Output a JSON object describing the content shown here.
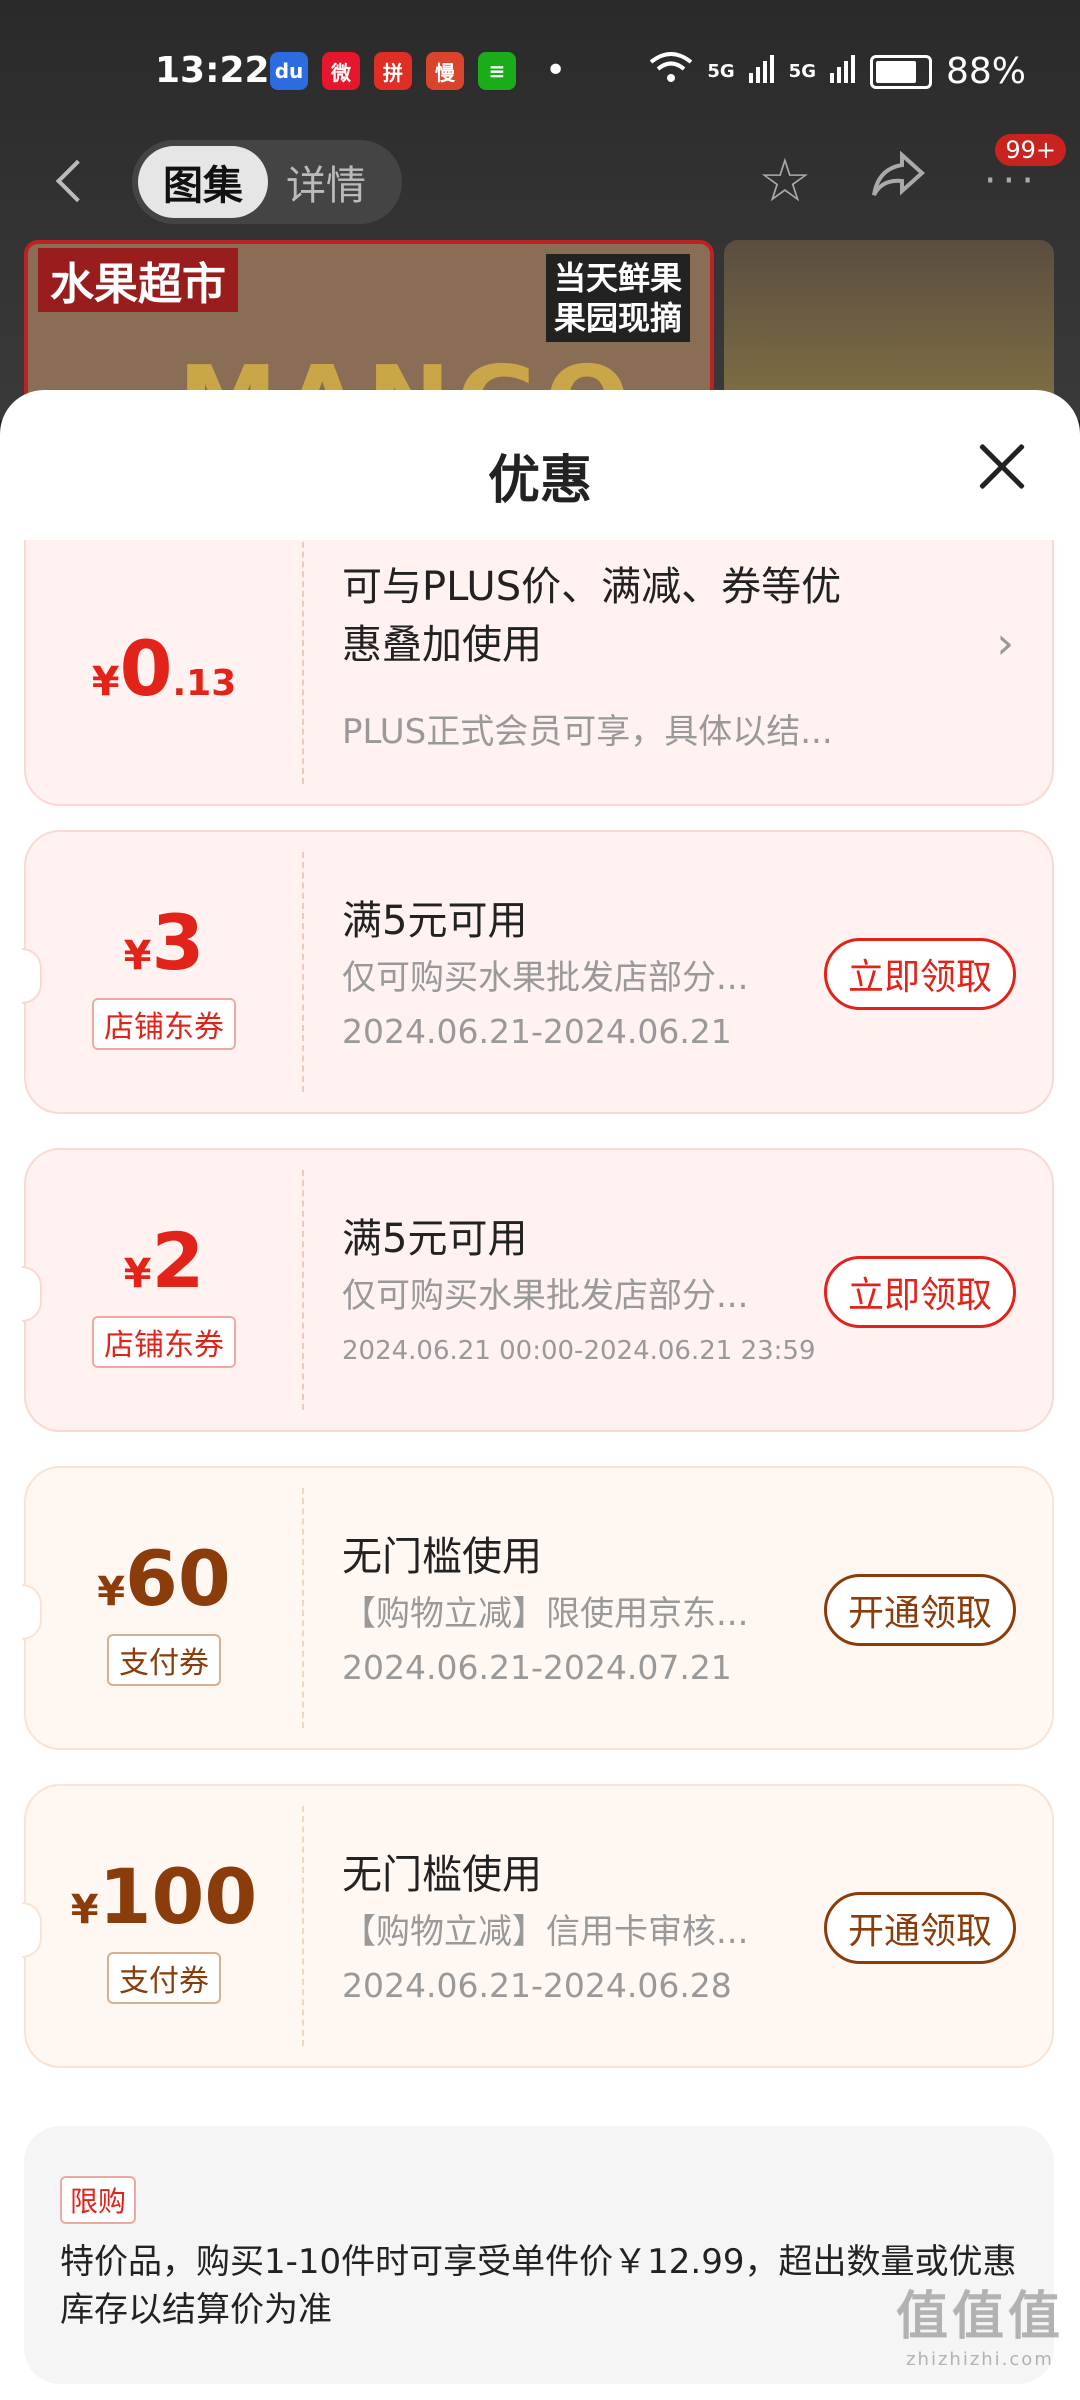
{
  "status_bar": {
    "time": "13:22",
    "apps": [
      {
        "icon": "baidu-icon",
        "glyph": "du",
        "color": "#2d6be0"
      },
      {
        "icon": "weibo-icon",
        "glyph": "微",
        "color": "#e6162d"
      },
      {
        "icon": "pdd-icon",
        "glyph": "拼",
        "color": "#e02e24"
      },
      {
        "icon": "man-icon",
        "glyph": "慢",
        "color": "#d9442b"
      },
      {
        "icon": "app-green-icon",
        "glyph": "≡",
        "color": "#1aad19"
      }
    ],
    "dot": "•",
    "signal1": "5G",
    "signal2": "5G",
    "battery": "88%"
  },
  "top_bar": {
    "tab_gallery": "图集",
    "tab_detail": "详情",
    "badge": "99+"
  },
  "banner": {
    "tag": "水果超市",
    "tag2_line1": "当天鲜果",
    "tag2_line2": "果园现摘",
    "product_text": "MANGO"
  },
  "sheet": {
    "title": "优惠"
  },
  "coupons": [
    {
      "style": "red",
      "currency": "¥",
      "amount": "0",
      "decimal": ".13",
      "title_line1": "可与PLUS价、满减、券等优",
      "title_line2": "惠叠加使用",
      "desc": "PLUS正式会员可享，具体以结..."
    },
    {
      "style": "red",
      "currency": "¥",
      "amount": "3",
      "type": "店铺东券",
      "title": "满5元可用",
      "desc": "仅可购买水果批发店部分...",
      "date": "2024.06.21-2024.06.21",
      "button": "立即领取"
    },
    {
      "style": "red",
      "currency": "¥",
      "amount": "2",
      "type": "店铺东券",
      "title": "满5元可用",
      "desc": "仅可购买水果批发店部分...",
      "date": "2024.06.21 00:00-2024.06.21 23:59",
      "button": "立即领取"
    },
    {
      "style": "gold",
      "currency": "¥",
      "amount": "60",
      "type": "支付券",
      "title": "无门槛使用",
      "desc": "【购物立减】限使用京东...",
      "date": "2024.06.21-2024.07.21",
      "button": "开通领取"
    },
    {
      "style": "gold",
      "currency": "¥",
      "amount": "100",
      "type": "支付券",
      "title": "无门槛使用",
      "desc": "【购物立减】信用卡审核...",
      "date": "2024.06.21-2024.06.28",
      "button": "开通领取"
    }
  ],
  "limit": {
    "tag": "限购",
    "text": "特价品，购买1-10件时可享受单件价￥12.99，超出数量或优惠库存以结算价为准"
  },
  "watermark": {
    "line1": "值值值",
    "line2": "zhizhizhi.com"
  }
}
